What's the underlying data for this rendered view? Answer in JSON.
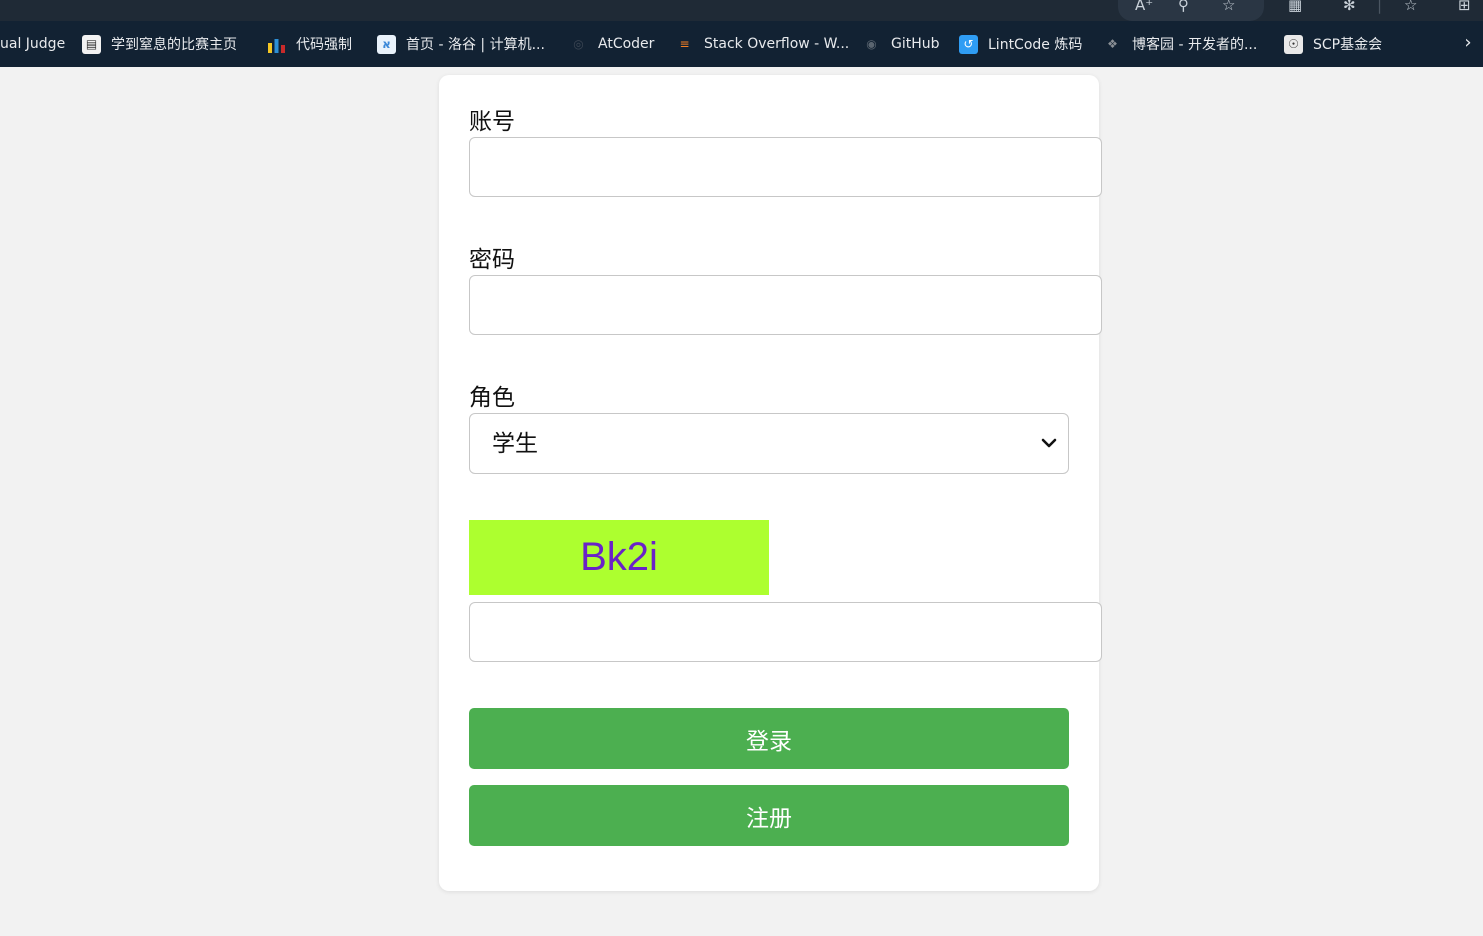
{
  "bookmarks": [
    {
      "label": "ual Judge",
      "icon": "none"
    },
    {
      "label": "学到窒息的比赛主页",
      "icon": "page-icon"
    },
    {
      "label": "代码强制",
      "icon": "bar-chart-icon"
    },
    {
      "label": "首页 - 洛谷 | 计算机...",
      "icon": "luogu-icon"
    },
    {
      "label": "AtCoder",
      "icon": "atcoder-icon"
    },
    {
      "label": "Stack Overflow - W...",
      "icon": "stackoverflow-icon"
    },
    {
      "label": "GitHub",
      "icon": "github-icon"
    },
    {
      "label": "LintCode 炼码",
      "icon": "lintcode-icon"
    },
    {
      "label": "博客园 - 开发者的...",
      "icon": "cnblogs-icon"
    },
    {
      "label": "SCP基金会",
      "icon": "scp-icon"
    }
  ],
  "form": {
    "account_label": "账号",
    "account_value": "",
    "password_label": "密码",
    "password_value": "",
    "role_label": "角色",
    "role_selected": "学生",
    "captcha_text": "Bk2i",
    "captcha_input_value": "",
    "login_label": "登录",
    "register_label": "注册"
  },
  "colors": {
    "button_green": "#4caf50",
    "captcha_bg": "#adff2f",
    "captcha_text": "#6a22c8",
    "bookmark_bar": "#122233"
  }
}
